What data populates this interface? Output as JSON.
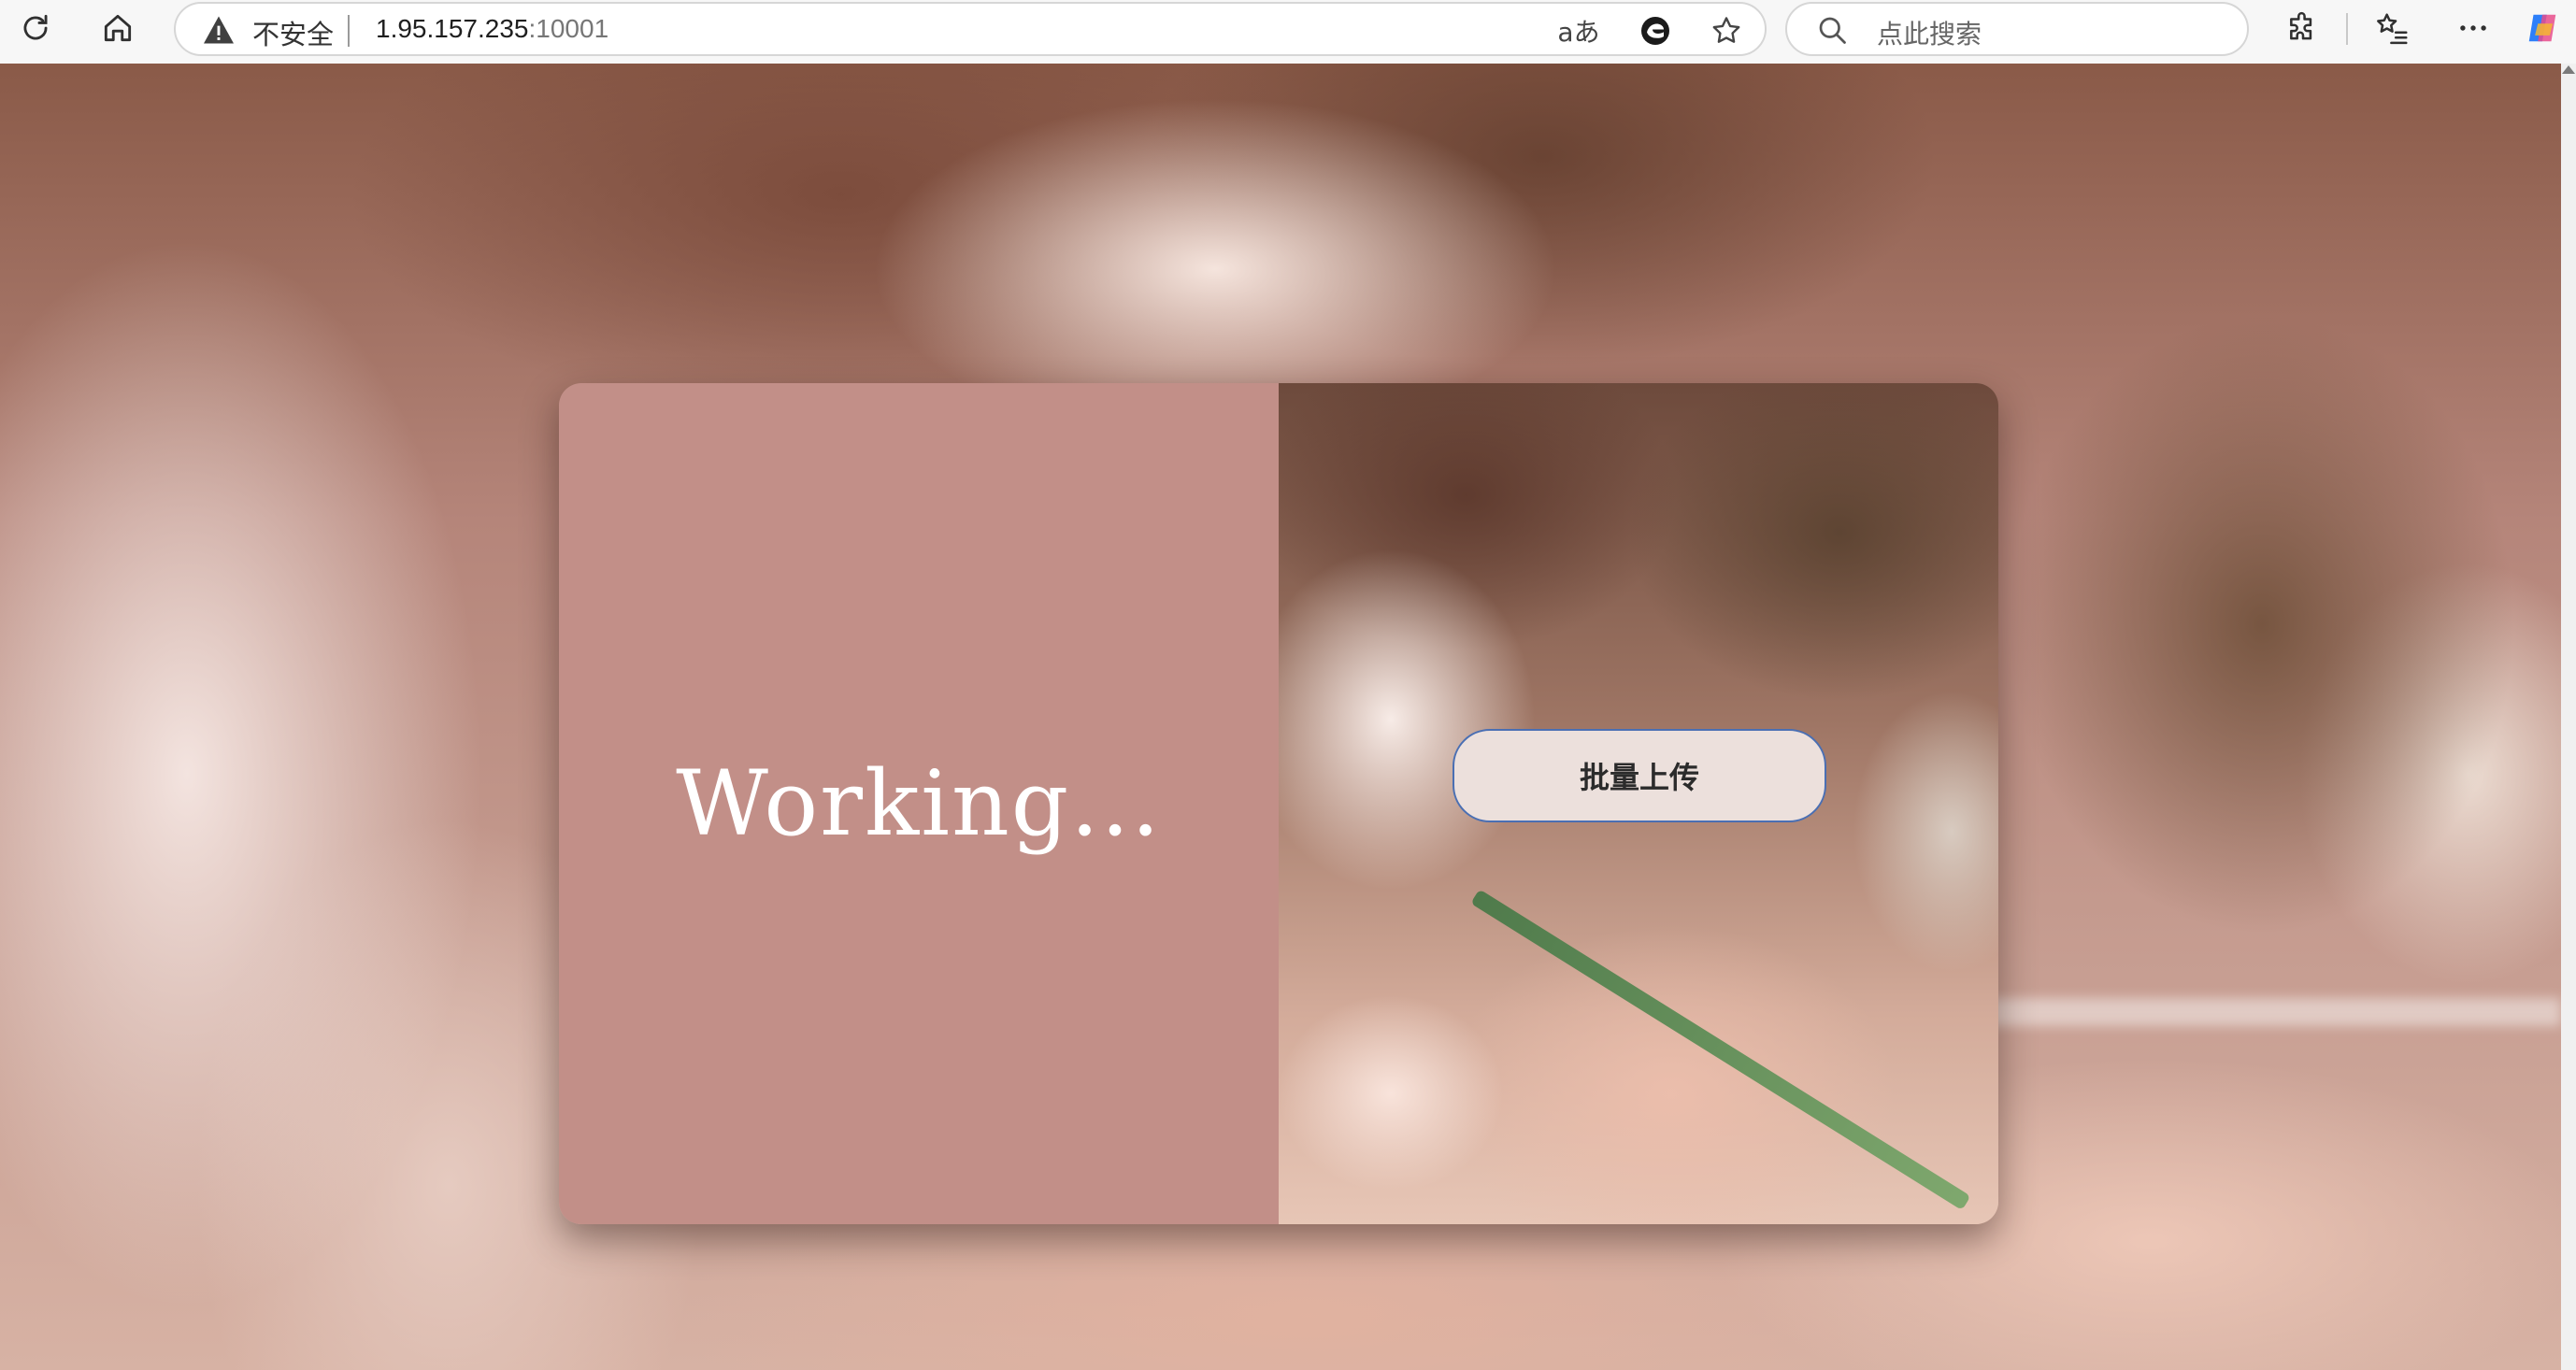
{
  "browser": {
    "security_label": "不安全",
    "url_host": "1.95.157.235",
    "url_port": ":10001",
    "read_aloud_label": "aあ",
    "search_placeholder": "点此搜索"
  },
  "icons": {
    "reload": "reload-icon",
    "home": "home-icon",
    "warning": "warning-icon",
    "read_aloud": "read-aloud-icon",
    "edge": "edge-icon",
    "favorite": "star-icon",
    "search": "search-icon",
    "extensions": "puzzle-icon",
    "favorites": "favorites-list-icon",
    "more": "more-icon",
    "copilot": "copilot-icon"
  },
  "page": {
    "status_text": "Working...",
    "upload_button_label": "批量上传"
  },
  "colors": {
    "card_left": "#c28f88",
    "button_bg": "#ece0dc",
    "button_border": "#4a6fb3"
  }
}
